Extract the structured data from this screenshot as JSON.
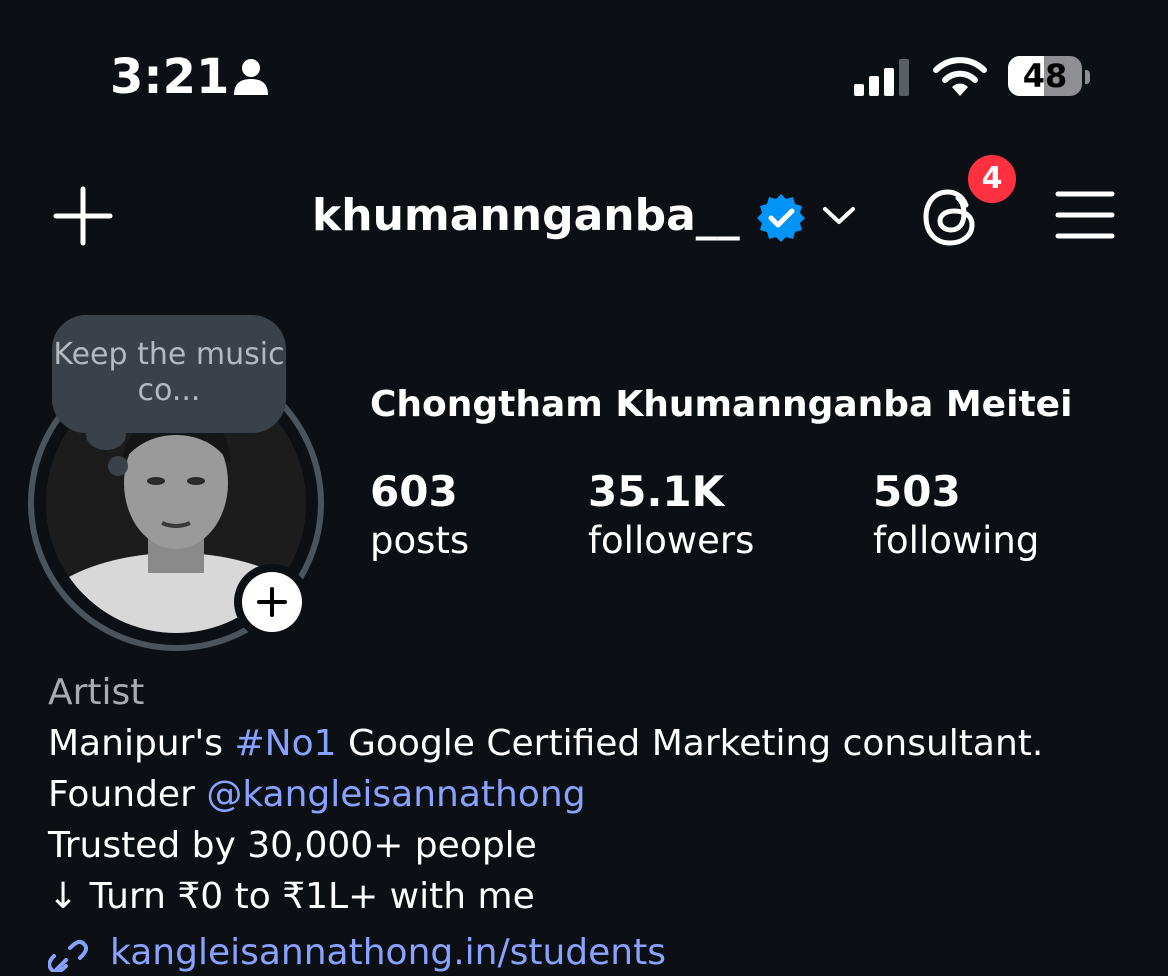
{
  "status_bar": {
    "time": "3:21",
    "battery_level": "48",
    "battery_fraction": 0.48,
    "icons": [
      "person-icon",
      "signal-icon",
      "wifi-icon",
      "battery-icon"
    ]
  },
  "header": {
    "username": "khumannganba__",
    "verified": true,
    "notification_count": "4",
    "icons": [
      "plus-icon",
      "verified-icon",
      "chevron-down-icon",
      "threads-icon",
      "menu-icon"
    ]
  },
  "profile": {
    "note": "Keep the music co...",
    "full_name": "Chongtham Khumannganba Meitei",
    "stats": [
      {
        "count": "603",
        "label": "posts"
      },
      {
        "count": "35.1K",
        "label": "followers"
      },
      {
        "count": "503",
        "label": "following"
      }
    ],
    "category": "Artist",
    "bio": {
      "line1_pre": "Manipur's ",
      "line1_tag": "#No1",
      "line1_post": " Google Certified Marketing consultant.",
      "line2_pre": "Founder ",
      "line2_mention": "@kangleisannathong",
      "line3": "Trusted by 30,000+ people",
      "line4": "↓ Turn ₹0 to ₹1L+ with me"
    },
    "link": "kangleisannathong.in/students"
  },
  "colors": {
    "background": "#0c1014",
    "accent_link": "#8aa2ff",
    "verified_blue": "#0095f6",
    "badge_red": "#ff3040"
  }
}
